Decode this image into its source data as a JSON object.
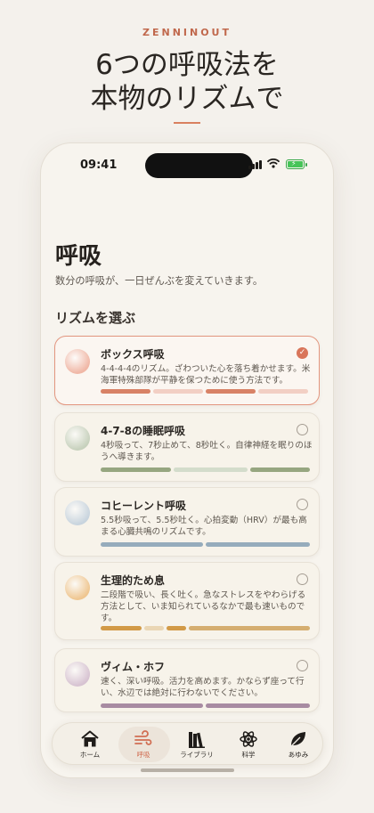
{
  "hero": {
    "brand": "ZENNINOUT",
    "line1": "6つの呼吸法を",
    "line2": "本物のリズムで"
  },
  "status_bar": {
    "time": "09:41"
  },
  "screen": {
    "title": "呼吸",
    "subtitle": "数分の呼吸が、一日ぜんぶを変えていきます。",
    "section_title": "リズムを選ぶ"
  },
  "techniques": [
    {
      "name": "ボックス呼吸",
      "description": "4-4-4-4のリズム。ざわついた心を落ち着かせます。米海軍特殊部隊が平静を保つために使う方法です。",
      "selected": true,
      "color": "#f0b7a6",
      "bar_colors": [
        "#d88266",
        "#f2cfc4",
        "#d88266",
        "#f2cfc4"
      ]
    },
    {
      "name": "4-7-8の睡眠呼吸",
      "description": "4秒吸って、7秒止めて、8秒吐く。自律神経を眠りのほうへ導きます。",
      "selected": false,
      "color": "#c7d1bd",
      "bar_colors": [
        "#96a680",
        "#d3dccb",
        "#96a680"
      ]
    },
    {
      "name": "コヒーレント呼吸",
      "description": "5.5秒吸って、5.5秒吐く。心拍変動（HRV）が最も高まる心臓共鳴のリズムです。",
      "selected": false,
      "color": "#c8d4de",
      "bar_colors": [
        "#96acbc",
        "#96acbc"
      ]
    },
    {
      "name": "生理的ため息",
      "description": "二段階で吸い、長く吐く。急なストレスをやわらげる方法として、いま知られているなかで最も速いものです。",
      "selected": false,
      "color": "#efc690",
      "bar_colors": [
        "#d29a47",
        "#ead6b4",
        "#d29a47",
        "#d5ae70"
      ]
    },
    {
      "name": "ヴィム・ホフ",
      "description": "速く、深い呼吸。活力を高めます。かならず座って行い、水辺では絶対に行わないでください。",
      "selected": false,
      "color": "#d7c3d2",
      "bar_colors": [
        "#a88ba2",
        "#a88ba2"
      ]
    }
  ],
  "tabs": [
    {
      "label": "ホーム",
      "icon": "home-icon"
    },
    {
      "label": "呼吸",
      "icon": "wind-icon",
      "active": true
    },
    {
      "label": "ライブラリ",
      "icon": "books-icon"
    },
    {
      "label": "科学",
      "icon": "atom-icon"
    },
    {
      "label": "あゆみ",
      "icon": "leaf-icon"
    }
  ],
  "accent_color": "#d9755a"
}
